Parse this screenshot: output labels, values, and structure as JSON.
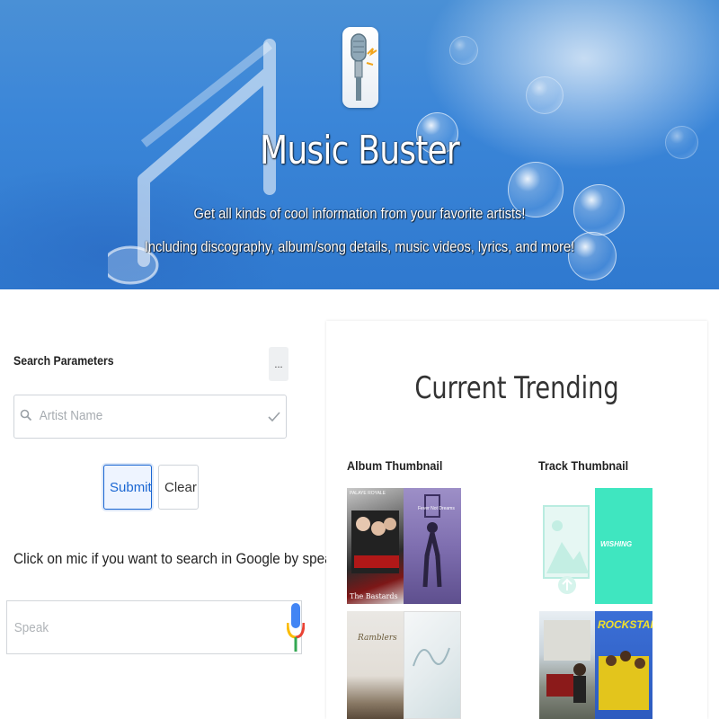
{
  "hero": {
    "title": "Music Buster",
    "subtitle_line1": "Get all kinds of cool information from your favorite artists!",
    "subtitle_line2": "Including discography, album/song details, music videos, lyrics, and more!"
  },
  "search": {
    "label": "Search Parameters",
    "more_label": "...",
    "artist_placeholder": "Artist Name",
    "submit_label": "Submit",
    "clear_label": "Clear"
  },
  "voice": {
    "instruction": "Click on mic if you want to search in Google by speaking!",
    "speak_placeholder": "Speak"
  },
  "trending": {
    "title": "Current Trending",
    "album_heading": "Album Thumbnail",
    "track_heading": "Track Thumbnail",
    "album_cover_texts": [
      "PALAYE ROYALE",
      "The Bastards",
      "Fever Not Dreams",
      "Ramblers"
    ],
    "track_cover_texts": [
      "WISHING",
      "ROCKSTAR"
    ]
  },
  "colors": {
    "hero_blue": "#3b86d8",
    "accent": "#1a66d2",
    "teal": "#3fe6c0"
  }
}
